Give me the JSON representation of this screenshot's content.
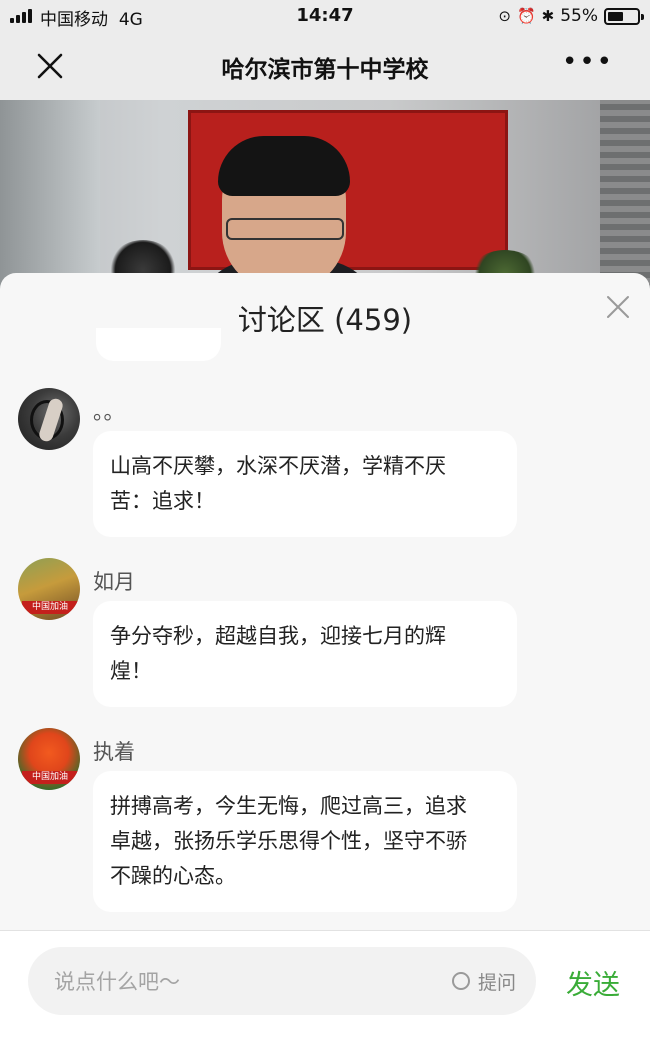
{
  "status_bar": {
    "carrier": "中国移动",
    "network": "4G",
    "time": "14:47",
    "battery_percent": "55%",
    "battery_level": 0.55
  },
  "nav": {
    "title": "哈尔滨市第十中学校",
    "close_icon": "close-icon",
    "more_icon": "more-icon"
  },
  "discussion": {
    "title": "讨论区 (459)",
    "messages": [
      {
        "name": "。。",
        "text": "山高不厌攀，水深不厌潜，学精不厌苦：追求！",
        "avatar": "avatar-dark-figure"
      },
      {
        "name": "如月",
        "text": "争分夺秒，超越自我，迎接七月的辉煌！",
        "avatar": "avatar-autumn-forest",
        "badge": "中国加油"
      },
      {
        "name": "执着",
        "text": "拼搏高考，今生无悔，爬过高三，追求卓越，张扬乐学乐思得个性，坚守不骄不躁的心态。",
        "avatar": "avatar-red-flowers",
        "badge": "中国加油"
      }
    ]
  },
  "input_bar": {
    "placeholder": "说点什么吧～",
    "ask_label": "提问",
    "send_label": "发送"
  },
  "colors": {
    "accent_green": "#3aac38",
    "banner_red": "#b8201d",
    "bubble_bg": "#ffffff",
    "sheet_bg": "#f7f7f7"
  }
}
